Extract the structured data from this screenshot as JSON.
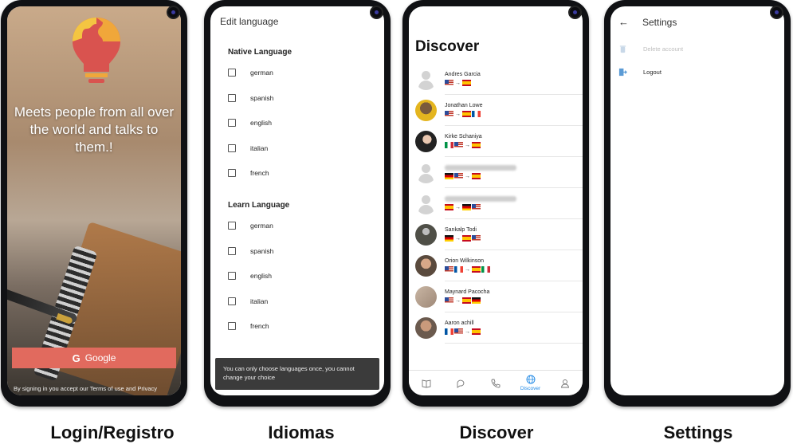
{
  "captions": {
    "login": "Login/Registro",
    "languages": "Idiomas",
    "discover": "Discover",
    "settings": "Settings"
  },
  "login": {
    "slogan": "Meets people from all over the world and talks to them.!",
    "google_button": "Google",
    "google_icon": "G",
    "terms_text": "By signing in you accept our Terms of use and Privacy"
  },
  "languages": {
    "title": "Edit language",
    "native_title": "Native Language",
    "native": [
      "german",
      "spanish",
      "english",
      "italian",
      "french"
    ],
    "learn_title": "Learn Language",
    "learn": [
      "german",
      "spanish",
      "english",
      "italian",
      "french"
    ],
    "toast": "You can only choose languages once, you cannot change your choice"
  },
  "discover": {
    "title": "Discover",
    "arrow": "→",
    "users": [
      {
        "name": "Andres Garcia",
        "native": [
          "us"
        ],
        "learn": [
          "es"
        ],
        "avatar": "placeholder"
      },
      {
        "name": "Jonathan Lowe",
        "native": [
          "us"
        ],
        "learn": [
          "es",
          "fr"
        ],
        "avatar": "photo-yellow"
      },
      {
        "name": "Kirke Schaniya",
        "native": [
          "it",
          "us"
        ],
        "learn": [
          "es"
        ],
        "avatar": "photo-dark"
      },
      {
        "name": "",
        "native": [
          "de",
          "us"
        ],
        "learn": [
          "es"
        ],
        "avatar": "placeholder"
      },
      {
        "name": "",
        "native": [
          "es"
        ],
        "learn": [
          "de",
          "us"
        ],
        "avatar": "placeholder"
      },
      {
        "name": "Sankalp Todi",
        "native": [
          "de"
        ],
        "learn": [
          "es",
          "us"
        ],
        "avatar": "photo-grey"
      },
      {
        "name": "Orion Wilkinson",
        "native": [
          "us",
          "fr"
        ],
        "learn": [
          "es",
          "it"
        ],
        "avatar": "photo-beard"
      },
      {
        "name": "Maynard Pacocha",
        "native": [
          "us"
        ],
        "learn": [
          "es",
          "de"
        ],
        "avatar": "photo-blur"
      },
      {
        "name": "Aaron achill",
        "native": [
          "fr",
          "us"
        ],
        "learn": [
          "es"
        ],
        "avatar": "photo-man"
      }
    ],
    "nav": {
      "discover_label": "Discover"
    }
  },
  "settings": {
    "title": "Settings",
    "delete_account": "Delete account",
    "logout": "Logout"
  },
  "colors": {
    "accent_blue": "#1e88e5",
    "google_red": "#e16a5e"
  }
}
